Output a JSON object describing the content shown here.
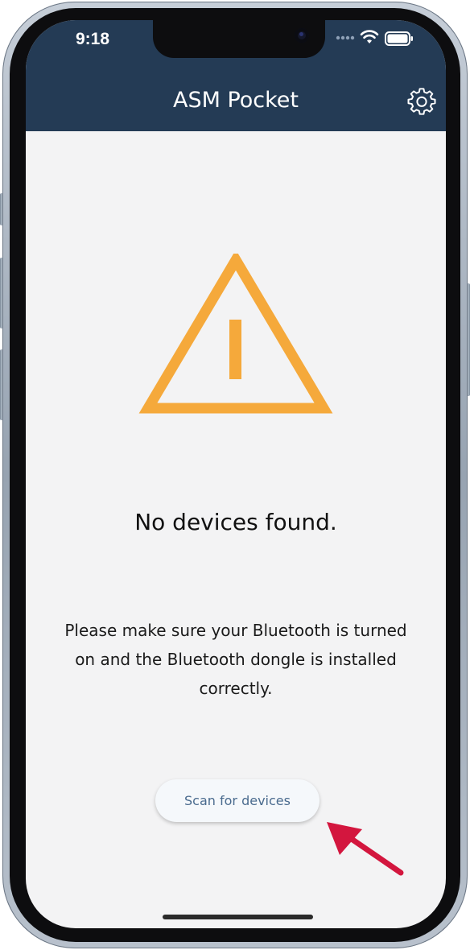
{
  "status_bar": {
    "time": "9:18",
    "icons": [
      "signal-dots-icon",
      "wifi-icon",
      "battery-icon"
    ]
  },
  "header": {
    "title": "ASM Pocket",
    "settings_icon": "gear-icon"
  },
  "main": {
    "warning_icon": "warning-triangle-icon",
    "heading": "No devices found.",
    "message": "Please make sure your Bluetooth is turned on and the Bluetooth dongle is installed correctly.",
    "scan_button_label": "Scan for devices"
  },
  "annotation": {
    "pointer": "red-arrow-icon"
  },
  "colors": {
    "header_bg": "#243b55",
    "warning": "#f5a93b",
    "screen_bg": "#f3f3f4",
    "button_text": "#4a6b8e",
    "annotation_arrow": "#d3163e"
  }
}
